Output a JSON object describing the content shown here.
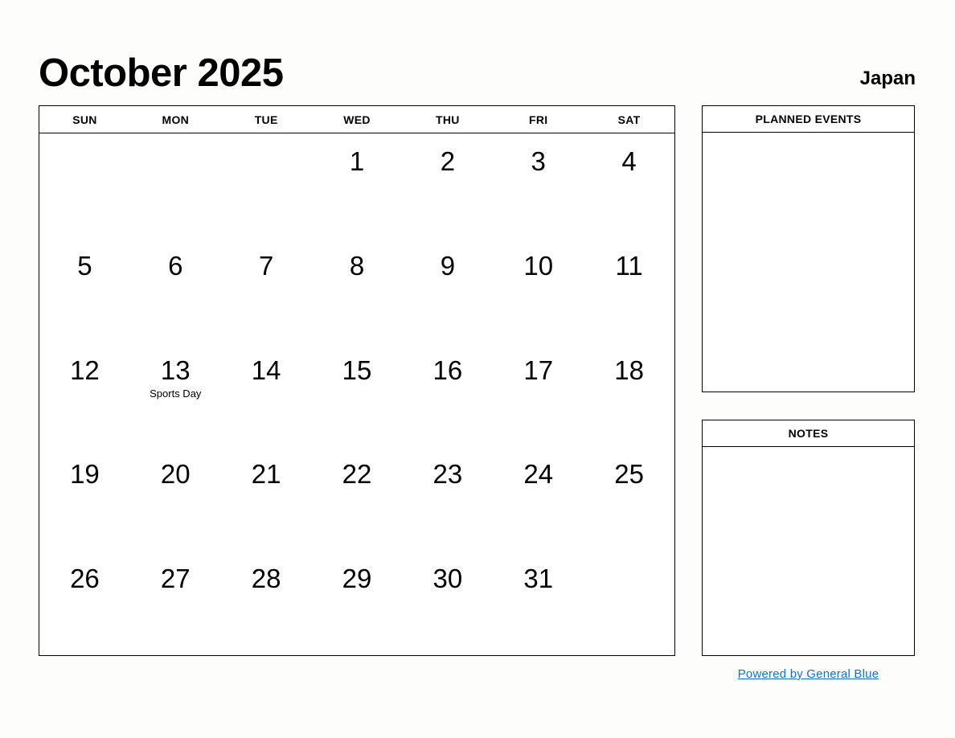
{
  "header": {
    "title": "October 2025",
    "region": "Japan"
  },
  "calendar": {
    "weekdays": [
      "SUN",
      "MON",
      "TUE",
      "WED",
      "THU",
      "FRI",
      "SAT"
    ],
    "weeks": [
      [
        {
          "day": "",
          "event": ""
        },
        {
          "day": "",
          "event": ""
        },
        {
          "day": "",
          "event": ""
        },
        {
          "day": "1",
          "event": ""
        },
        {
          "day": "2",
          "event": ""
        },
        {
          "day": "3",
          "event": ""
        },
        {
          "day": "4",
          "event": ""
        }
      ],
      [
        {
          "day": "5",
          "event": ""
        },
        {
          "day": "6",
          "event": ""
        },
        {
          "day": "7",
          "event": ""
        },
        {
          "day": "8",
          "event": ""
        },
        {
          "day": "9",
          "event": ""
        },
        {
          "day": "10",
          "event": ""
        },
        {
          "day": "11",
          "event": ""
        }
      ],
      [
        {
          "day": "12",
          "event": ""
        },
        {
          "day": "13",
          "event": "Sports Day"
        },
        {
          "day": "14",
          "event": ""
        },
        {
          "day": "15",
          "event": ""
        },
        {
          "day": "16",
          "event": ""
        },
        {
          "day": "17",
          "event": ""
        },
        {
          "day": "18",
          "event": ""
        }
      ],
      [
        {
          "day": "19",
          "event": ""
        },
        {
          "day": "20",
          "event": ""
        },
        {
          "day": "21",
          "event": ""
        },
        {
          "day": "22",
          "event": ""
        },
        {
          "day": "23",
          "event": ""
        },
        {
          "day": "24",
          "event": ""
        },
        {
          "day": "25",
          "event": ""
        }
      ],
      [
        {
          "day": "26",
          "event": ""
        },
        {
          "day": "27",
          "event": ""
        },
        {
          "day": "28",
          "event": ""
        },
        {
          "day": "29",
          "event": ""
        },
        {
          "day": "30",
          "event": ""
        },
        {
          "day": "31",
          "event": ""
        },
        {
          "day": "",
          "event": ""
        }
      ]
    ]
  },
  "panels": {
    "planned_events": {
      "title": "PLANNED EVENTS",
      "content": ""
    },
    "notes": {
      "title": "NOTES",
      "content": ""
    }
  },
  "footer": {
    "link_text": "Powered by General Blue",
    "link_color": "#1a6fc4"
  }
}
